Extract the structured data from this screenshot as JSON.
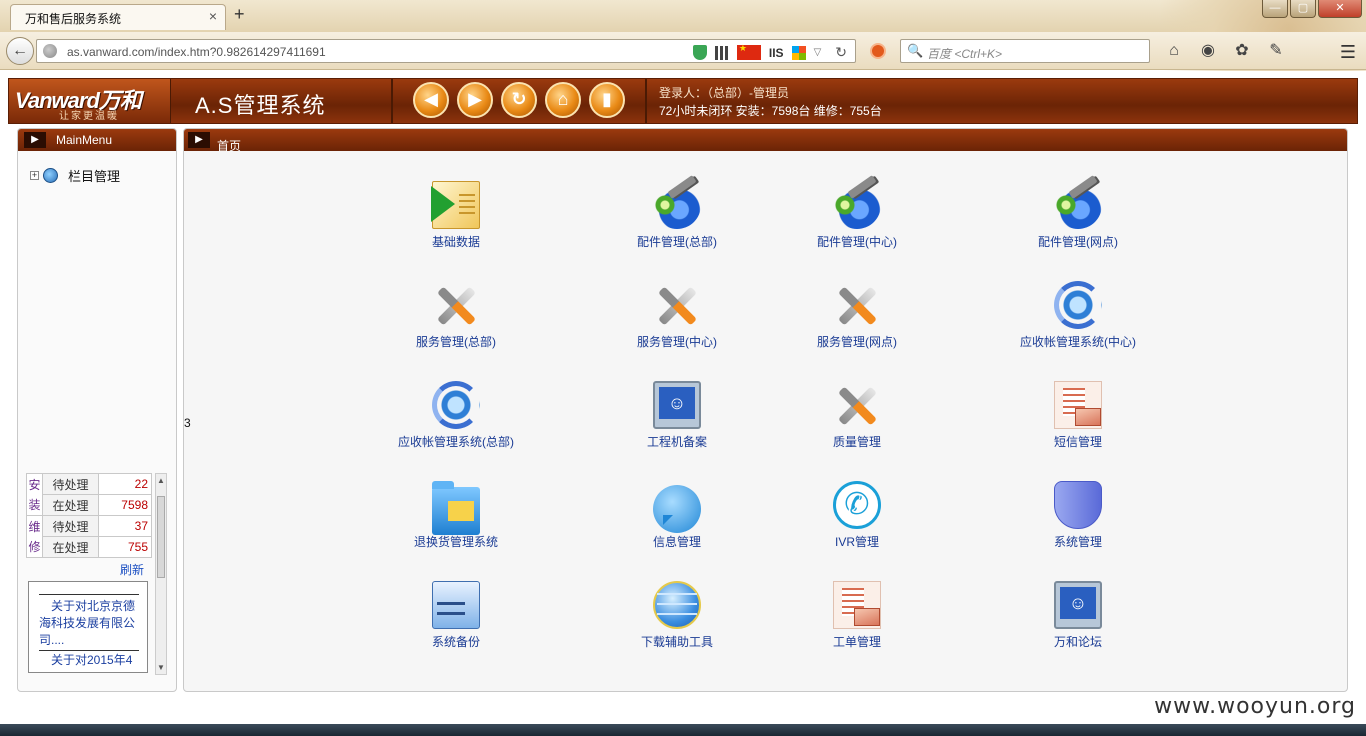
{
  "browser": {
    "tab_title": "万和售后服务系统",
    "url_host": "as.vanward.com",
    "url_path": "/index.htm?0.982614297411691",
    "search_placeholder": "百度 <Ctrl+K>",
    "iis_label": "IIS",
    "tab_close": "×",
    "new_tab": "+"
  },
  "header": {
    "logo_text": "Vanward万和",
    "logo_sub": "让家更温暖",
    "system_title": "A.S管理系统",
    "login_line": "登录人：（总部）-管理员",
    "stats_line": "72小时未闭环 安装：7598台 维修：755台"
  },
  "sidebar": {
    "title": "MainMenu",
    "tree_item": "栏目管理",
    "stats": {
      "install_label": "安装",
      "repair_label": "维修",
      "rows": [
        {
          "label": "待处理",
          "value": "22"
        },
        {
          "label": "在处理",
          "value": "7598"
        },
        {
          "label": "待处理",
          "value": "37"
        },
        {
          "label": "在处理",
          "value": "755"
        }
      ]
    },
    "refresh": "刷新",
    "news": [
      "关于对北京京德海科技发展有限公司....",
      "关于对2015年4"
    ]
  },
  "main": {
    "title": "首页",
    "stray_text": "3",
    "modules": [
      {
        "label": "基础数据",
        "icon": "basic-data-icon"
      },
      {
        "label": "配件管理(总部)",
        "icon": "parts-gear-icon"
      },
      {
        "label": "配件管理(中心)",
        "icon": "parts-gear-icon"
      },
      {
        "label": "配件管理(网点)",
        "icon": "parts-gear-icon"
      },
      {
        "label": "服务管理(总部)",
        "icon": "tools-icon"
      },
      {
        "label": "服务管理(中心)",
        "icon": "tools-icon"
      },
      {
        "label": "服务管理(网点)",
        "icon": "tools-icon"
      },
      {
        "label": "应收帐管理系统(中心)",
        "icon": "sync-globe-icon"
      },
      {
        "label": "应收帐管理系统(总部)",
        "icon": "sync-globe-icon"
      },
      {
        "label": "工程机备案",
        "icon": "monitor-icon"
      },
      {
        "label": "质量管理",
        "icon": "tools-icon"
      },
      {
        "label": "短信管理",
        "icon": "sms-document-icon"
      },
      {
        "label": "退换货管理系统",
        "icon": "folder-icon"
      },
      {
        "label": "信息管理",
        "icon": "chat-bubble-icon"
      },
      {
        "label": "IVR管理",
        "icon": "phone-icon"
      },
      {
        "label": "系统管理",
        "icon": "shield-icon"
      },
      {
        "label": "系统备份",
        "icon": "cabinet-icon"
      },
      {
        "label": "下载辅助工具",
        "icon": "ie-globe-icon"
      },
      {
        "label": "工单管理",
        "icon": "sms-document-icon"
      },
      {
        "label": "万和论坛",
        "icon": "monitor-icon"
      }
    ]
  },
  "watermark": "www.wooyun.org"
}
